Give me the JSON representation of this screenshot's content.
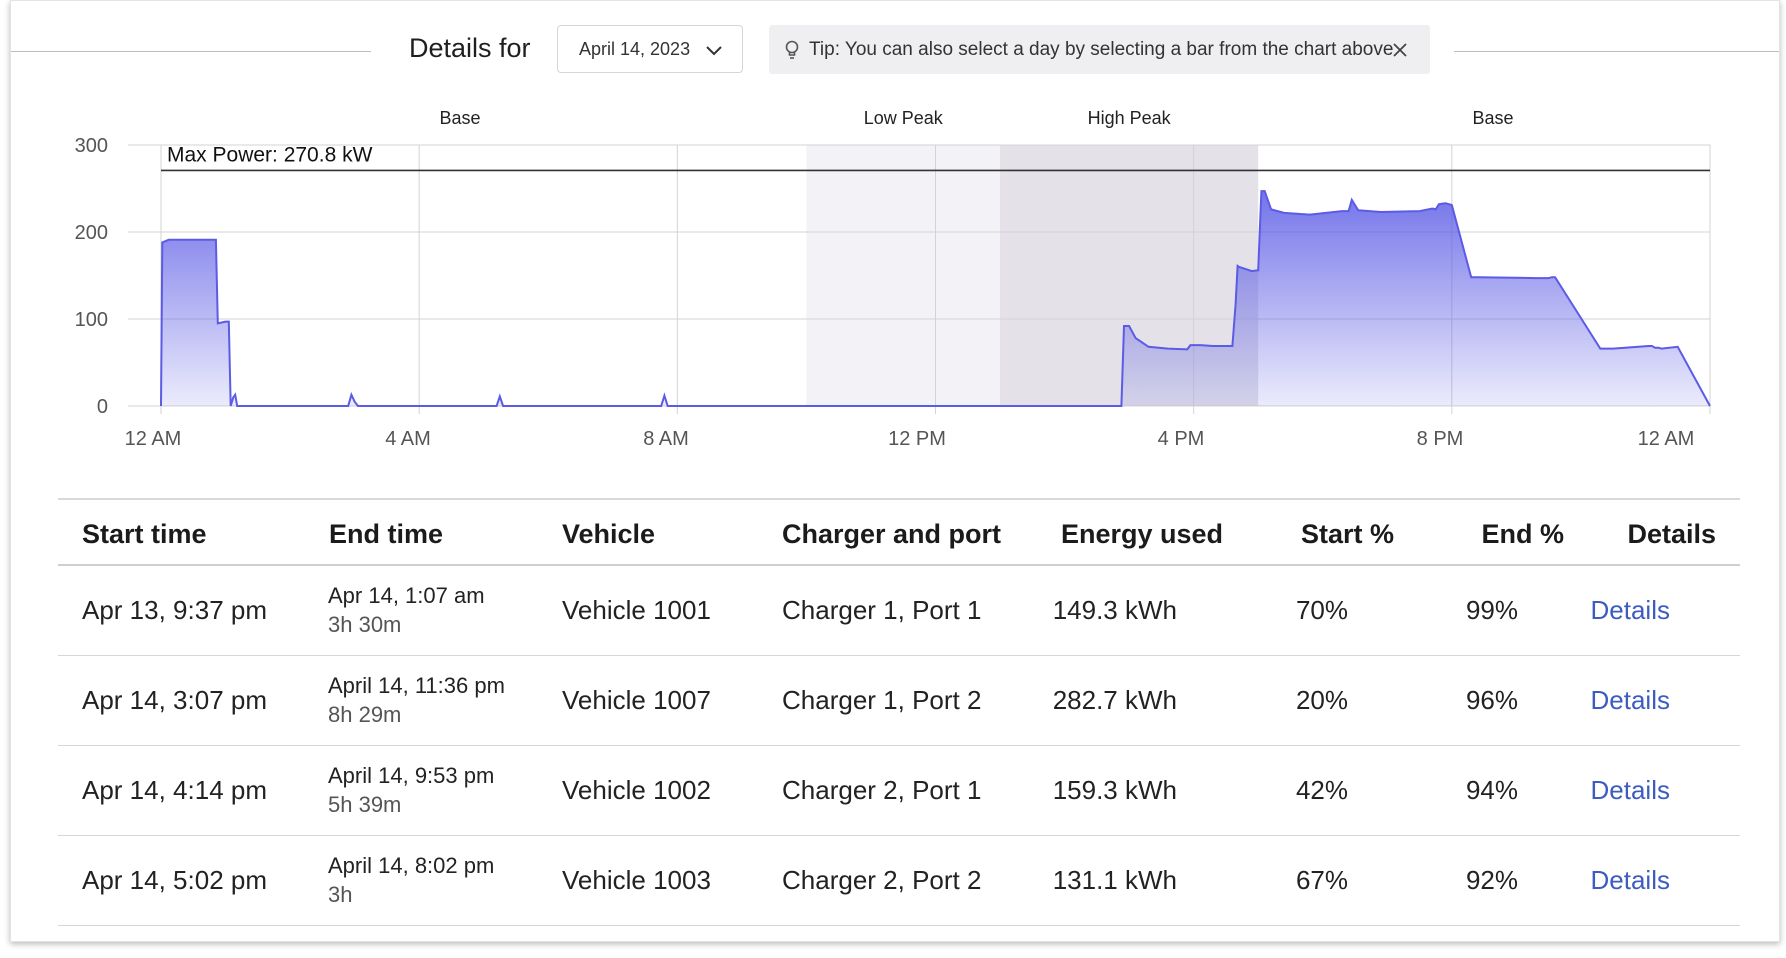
{
  "header": {
    "title": "Details for",
    "date_value": "April 14, 2023",
    "tip_text": "Tip: You can also select a day by selecting a bar from the chart above",
    "icons": {
      "dropdown": "chevron-down-icon",
      "tip": "lightbulb-icon",
      "close": "close-icon"
    }
  },
  "chart_data": {
    "type": "area",
    "ylim": [
      0,
      300
    ],
    "y_ticks": [
      0,
      100,
      200,
      300
    ],
    "x_ticks": [
      "12 AM",
      "4 AM",
      "8 AM",
      "12 PM",
      "4 PM",
      "8 PM",
      "12 AM"
    ],
    "grid": true,
    "color": "#5b5be6",
    "periods": [
      {
        "label": "Base",
        "start_hour": 0,
        "end_hour": 10
      },
      {
        "label": "Low Peak",
        "start_hour": 10,
        "end_hour": 13
      },
      {
        "label": "High Peak",
        "start_hour": 13,
        "end_hour": 17
      },
      {
        "label": "Base",
        "start_hour": 17,
        "end_hour": 24
      }
    ],
    "max_power": {
      "label": "Max Power: 270.8 kW",
      "value": 270.8
    },
    "series": [
      {
        "x": [
          0,
          0.02,
          0.12,
          0.85,
          0.88,
          1.0,
          1.05,
          1.08,
          1.12,
          1.15,
          1.18,
          1.3,
          2.9,
          2.95,
          3.0,
          3.05,
          5.2,
          5.25,
          5.3,
          7.75,
          7.8,
          7.85,
          14.88,
          14.92,
          15.0,
          15.1,
          15.3,
          15.6,
          15.9,
          15.95,
          16.05,
          16.1,
          16.3,
          16.6,
          16.65,
          16.68,
          16.7,
          16.9,
          17.0,
          17.05,
          17.1,
          17.2,
          17.4,
          17.8,
          18.3,
          18.4,
          18.45,
          18.55,
          18.9,
          19.5,
          19.7,
          19.75,
          19.8,
          19.9,
          20.0,
          20.3,
          20.4,
          21.3,
          21.5,
          21.55,
          21.6,
          22.3,
          22.45,
          22.5,
          23.05,
          23.1,
          23.15,
          23.2,
          23.25,
          23.5,
          24.0
        ],
        "y": [
          0,
          188,
          191,
          191,
          95,
          97,
          97,
          0,
          10,
          13,
          0,
          0,
          0,
          13,
          5,
          0,
          0,
          11,
          0,
          0,
          12,
          0,
          0,
          92,
          92,
          78,
          68,
          66,
          65,
          70,
          70,
          70,
          69,
          69,
          117,
          161,
          160,
          155,
          156,
          247,
          247,
          226,
          222,
          220,
          224,
          224,
          237,
          225,
          223,
          224,
          227,
          226,
          232,
          233,
          231,
          148,
          148,
          147,
          147,
          148,
          148,
          66,
          66,
          66,
          69,
          69,
          67,
          67,
          66,
          68,
          0
        ]
      }
    ]
  },
  "table": {
    "headers": [
      "Start time",
      "End time",
      "Vehicle",
      "Charger and port",
      "Energy used",
      "Start %",
      "End %",
      "Details"
    ],
    "rows": [
      {
        "start": "Apr 13, 9:37 pm",
        "end": "Apr 14, 1:07 am",
        "duration": "3h 30m",
        "vehicle": "Vehicle 1001",
        "charger": "Charger 1, Port 1",
        "energy": "149.3 kWh",
        "start_pct": "70%",
        "end_pct": "99%",
        "details": "Details"
      },
      {
        "start": "Apr 14, 3:07 pm",
        "end": "April 14, 11:36 pm",
        "duration": "8h 29m",
        "vehicle": "Vehicle 1007",
        "charger": "Charger 1, Port 2",
        "energy": "282.7 kWh",
        "start_pct": "20%",
        "end_pct": "96%",
        "details": "Details"
      },
      {
        "start": "Apr 14, 4:14 pm",
        "end": "April 14, 9:53 pm",
        "duration": "5h 39m",
        "vehicle": "Vehicle 1002",
        "charger": "Charger 2, Port 1",
        "energy": "159.3 kWh",
        "start_pct": "42%",
        "end_pct": "94%",
        "details": "Details"
      },
      {
        "start": "Apr 14, 5:02 pm",
        "end": "April 14, 8:02 pm",
        "duration": "3h",
        "vehicle": "Vehicle 1003",
        "charger": "Charger 2, Port 2",
        "energy": "131.1 kWh",
        "start_pct": "67%",
        "end_pct": "92%",
        "details": "Details"
      }
    ]
  }
}
